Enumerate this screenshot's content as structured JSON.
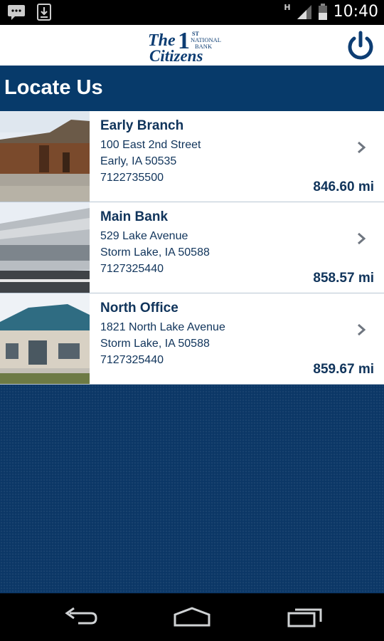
{
  "status_bar": {
    "time": "10:40",
    "network_label": "H",
    "icons": [
      "chat-bubble-icon",
      "download-icon",
      "signal-icon",
      "battery-icon"
    ]
  },
  "header": {
    "logo": {
      "word1": "The",
      "word2": "Citizens",
      "numeral": "1",
      "tagline1": "ST",
      "tagline2": "NATIONAL",
      "tagline3": "BANK"
    },
    "power_icon": "power-icon"
  },
  "page": {
    "title": "Locate Us"
  },
  "locations": [
    {
      "name": "Early Branch",
      "street": "100 East 2nd Street",
      "city": "Early, IA 50535",
      "phone": "7122735500",
      "distance": "846.60 mi"
    },
    {
      "name": "Main Bank",
      "street": "529 Lake Avenue",
      "city": "Storm Lake, IA 50588",
      "phone": "7127325440",
      "distance": "858.57 mi"
    },
    {
      "name": "North Office",
      "street": "1821 North Lake Avenue",
      "city": "Storm Lake, IA 50588",
      "phone": "7127325440",
      "distance": "859.67 mi"
    }
  ],
  "nav_bar": {
    "icons": [
      "back-icon",
      "home-icon",
      "recent-apps-icon"
    ]
  },
  "colors": {
    "primary": "#073a6a",
    "text": "#10345b",
    "background": "#0b3766"
  }
}
